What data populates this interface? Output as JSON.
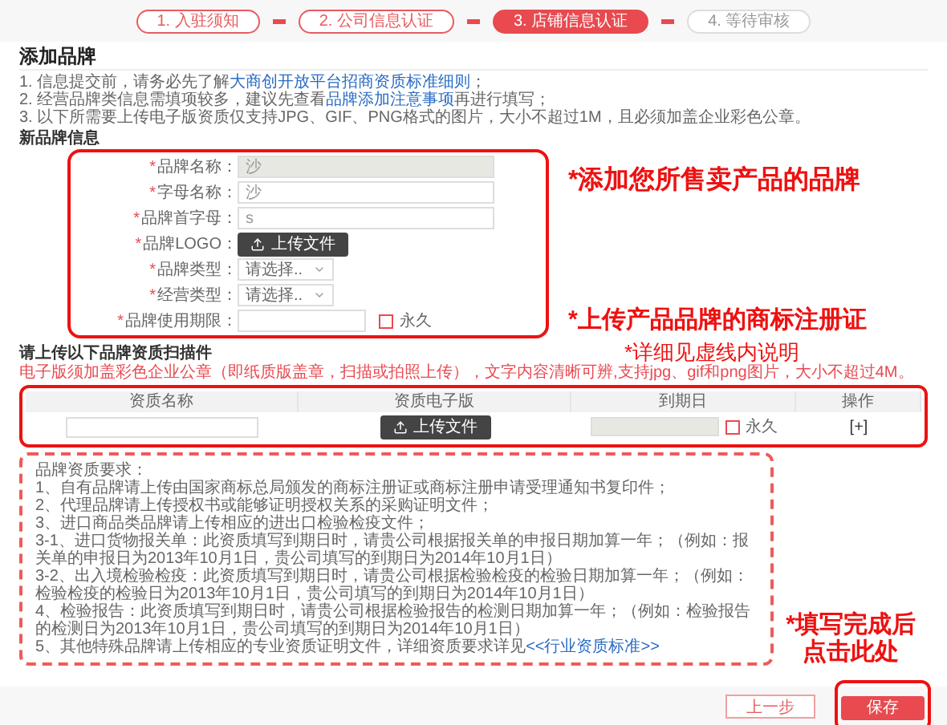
{
  "steps": [
    {
      "label": "1. 入驻须知",
      "selected": false,
      "done": true
    },
    {
      "label": "2. 公司信息认证",
      "selected": false,
      "done": true
    },
    {
      "label": "3. 店铺信息认证",
      "selected": true,
      "done": false
    },
    {
      "label": "4. 等待审核",
      "selected": false,
      "done": false
    }
  ],
  "title": "添加品牌",
  "notes": [
    {
      "text": "1. 信息提交前，请务必先了解",
      "link": "大商创开放平台招商资质标准细则",
      "after": "；"
    },
    {
      "text": "2. 经营品牌类信息需填项较多，建议先查看",
      "link": "品牌添加注意事项",
      "after": "再进行填写；"
    },
    {
      "text": "3. 以下所需要上传电子版资质仅支持JPG、GIF、PNG格式的图片，大小不超过1M，且必须加盖企业彩色公章。"
    }
  ],
  "brand_section": {
    "heading": "新品牌信息",
    "fields": [
      {
        "kind": "text",
        "mark": "*",
        "label": "品牌名称：",
        "value": "沙",
        "disabled": true
      },
      {
        "kind": "text",
        "mark": "*",
        "label": "字母名称：",
        "value": "沙",
        "disabled": false
      },
      {
        "kind": "text",
        "mark": "*",
        "label": "品牌首字母：",
        "value": "s",
        "disabled": false
      },
      {
        "kind": "upload",
        "mark": "*",
        "label": "品牌LOGO：",
        "button": "上传文件"
      },
      {
        "kind": "select",
        "mark": "*",
        "label": "品牌类型：",
        "placeholder": "请选择.."
      },
      {
        "kind": "select",
        "mark": "*",
        "label": "经营类型：",
        "placeholder": "请选择.."
      },
      {
        "kind": "date",
        "mark": "*",
        "label": "品牌使用期限：",
        "checkbox": "永久",
        "checked": false
      }
    ]
  },
  "annotations": {
    "brand": "*添加您所售卖产品的品牌",
    "certificate": "*上传产品品牌的商标注册证",
    "details": "*详细见虚线内说明",
    "finish": [
      "*填写完成后",
      "点击此处"
    ]
  },
  "qualification": {
    "heading": "请上传以下品牌资质扫描件",
    "warning": "电子版须加盖彩色企业公章（即纸质版盖章，扫描或拍照上传），文字内容清晰可辨,支持jpg、gif和png图片，大小不超过4M。",
    "columns": [
      "资质名称",
      "资质电子版",
      "到期日",
      "操作"
    ],
    "row": {
      "upload": "上传文件",
      "checkbox": "永久",
      "checked": false,
      "action": "[+]"
    }
  },
  "requirements": {
    "heading": "品牌资质要求：",
    "items": [
      {
        "text": "1、自有品牌请上传由国家商标总局颁发的商标注册证或商标注册申请受理通知书复印件；"
      },
      {
        "text": "2、代理品牌请上传授权书或能够证明授权关系的采购证明文件；"
      },
      {
        "text": "3、进口商品类品牌请上传相应的进出口检验检疫文件；"
      },
      {
        "text": "3-1、进口货物报关单：此资质填写到期日时，请贵公司根据报关单的申报日期加算一年；（例如：报关单的申报日为2013年10月1日，贵公司填写的到期日为2014年10月1日）"
      },
      {
        "text": "3-2、出入境检验检疫：此资质填写到期日时，请贵公司根据检验检疫的检验日期加算一年；（例如：检验检疫的检验日为2013年10月1日，贵公司填写的到期日为2014年10月1日）"
      },
      {
        "text": "4、检验报告：此资质填写到期日时，请贵公司根据检验报告的检测日期加算一年；（例如：检验报告的检测日为2013年10月1日，贵公司填写的到期日为2014年10月1日）"
      },
      {
        "text": "5、其他特殊品牌请上传相应的专业资质证明文件，详细资质要求详见",
        "link": "<<行业资质标准>>"
      }
    ]
  },
  "buttons": {
    "back": "上一步",
    "save": "保存"
  }
}
